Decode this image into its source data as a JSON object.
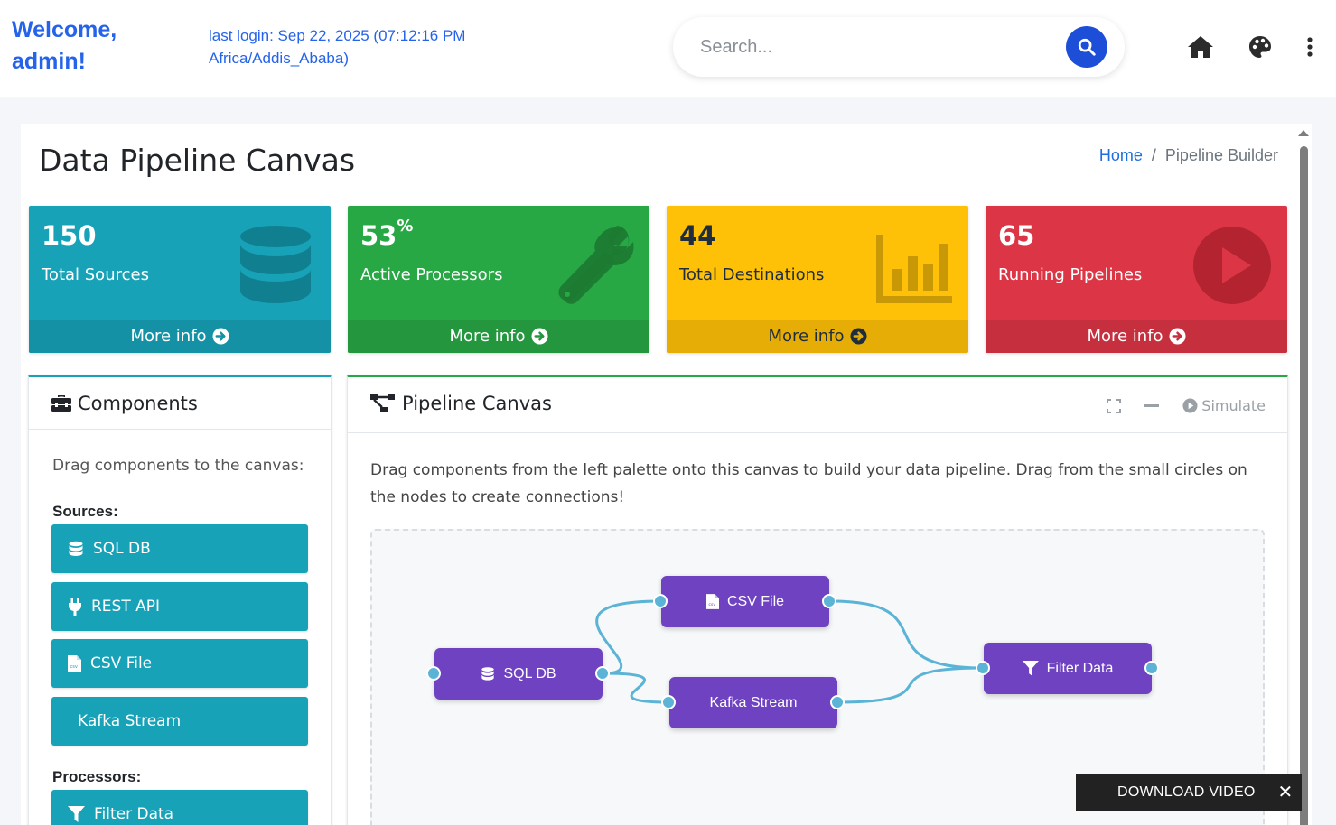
{
  "header": {
    "welcome": "Welcome, admin!",
    "last_login": "last login: Sep 22, 2025 (07:12:16 PM Africa/Addis_Ababa)",
    "search_placeholder": "Search...",
    "icons": [
      "search-icon",
      "home-icon",
      "palette-icon",
      "more-vertical-icon"
    ]
  },
  "page": {
    "title": "Data Pipeline Canvas",
    "breadcrumb": {
      "home": "Home",
      "separator": "/",
      "current": "Pipeline Builder"
    }
  },
  "stats": [
    {
      "value": "150",
      "suffix": "",
      "label": "Total Sources",
      "link": "More info",
      "color": "#17a2b8",
      "icon": "database-icon"
    },
    {
      "value": "53",
      "suffix": "%",
      "label": "Active Processors",
      "link": "More info",
      "color": "#28a745",
      "icon": "wrench-icon"
    },
    {
      "value": "44",
      "suffix": "",
      "label": "Total Destinations",
      "link": "More info",
      "color": "#ffc107",
      "icon": "bar-chart-icon"
    },
    {
      "value": "65",
      "suffix": "",
      "label": "Running Pipelines",
      "link": "More info",
      "color": "#dc3545",
      "icon": "play-circle-icon"
    }
  ],
  "components": {
    "title": "Components",
    "hint": "Drag components to the canvas:",
    "sources_label": "Sources:",
    "sources": [
      {
        "label": "SQL DB",
        "icon": "database-icon"
      },
      {
        "label": "REST API",
        "icon": "plug-icon"
      },
      {
        "label": "CSV File",
        "icon": "csv-file-icon"
      },
      {
        "label": "Kafka Stream",
        "icon": ""
      }
    ],
    "processors_label": "Processors:",
    "processors": [
      {
        "label": "Filter Data",
        "icon": "filter-icon"
      }
    ]
  },
  "canvas": {
    "title": "Pipeline Canvas",
    "simulate_label": "Simulate",
    "description": "Drag components from the left palette onto this canvas to build your data pipeline. Drag from the small circles on the nodes to create connections!",
    "node_color": "#6f42c1",
    "connection_color": "#5bb3d6",
    "nodes": [
      {
        "id": "sql",
        "label": "SQL DB",
        "icon": "database-icon"
      },
      {
        "id": "csv",
        "label": "CSV File",
        "icon": "csv-file-icon"
      },
      {
        "id": "kafka",
        "label": "Kafka Stream",
        "icon": ""
      },
      {
        "id": "filter",
        "label": "Filter Data",
        "icon": "filter-icon"
      }
    ],
    "connections": [
      {
        "from": "sql",
        "to": "csv"
      },
      {
        "from": "sql",
        "to": "kafka"
      },
      {
        "from": "csv",
        "to": "filter"
      },
      {
        "from": "kafka",
        "to": "filter"
      }
    ]
  },
  "toast": {
    "label": "DOWNLOAD VIDEO",
    "close": "✕"
  }
}
